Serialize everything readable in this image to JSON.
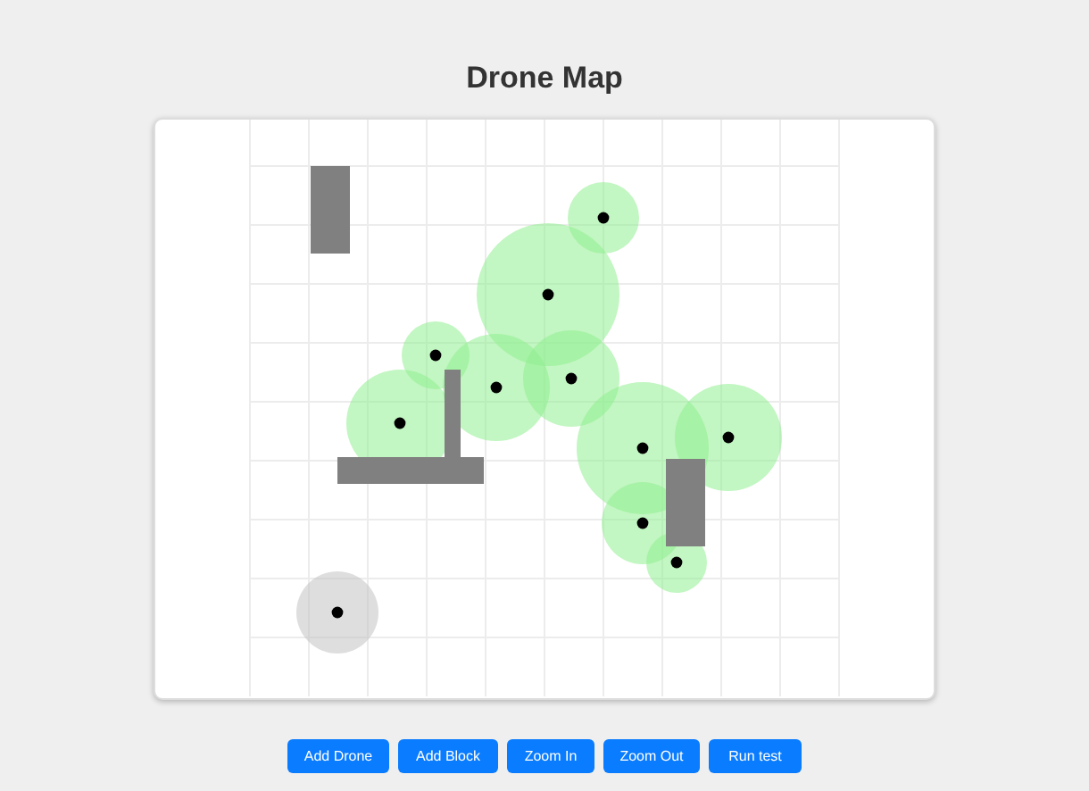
{
  "title": "Drone Map",
  "drones": [
    {
      "active": true
    },
    {
      "active": true
    },
    {
      "active": true
    },
    {
      "active": true
    },
    {
      "active": true
    },
    {
      "active": true
    },
    {
      "active": true
    },
    {
      "active": true
    },
    {
      "active": true
    },
    {
      "active": true
    },
    {
      "active": false
    }
  ],
  "buttons": [
    "Add Drone",
    "Add Block",
    "Zoom In",
    "Zoom Out",
    "Run test"
  ]
}
